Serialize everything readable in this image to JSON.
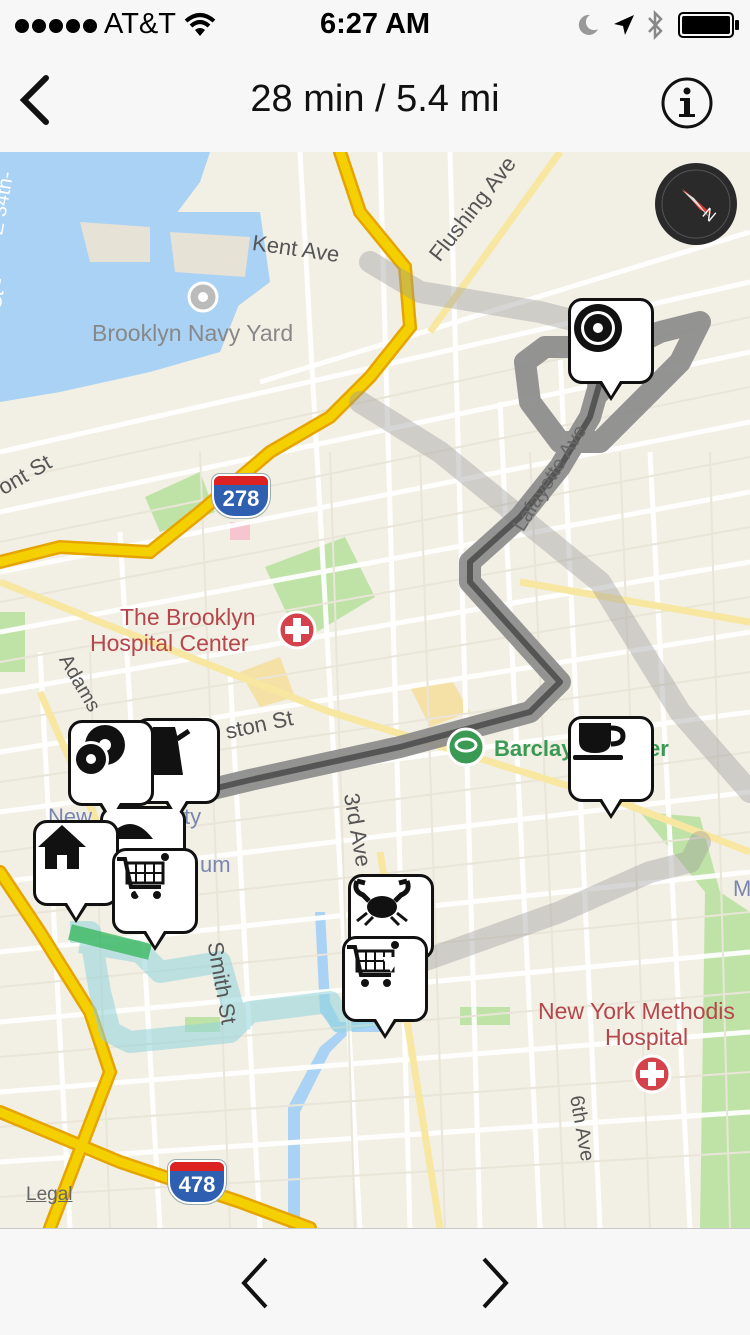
{
  "status_bar": {
    "carrier": "AT&T",
    "time": "6:27 AM",
    "icons": [
      "signal-dots-icon",
      "wifi-icon",
      "moon-icon",
      "location-arrow-icon",
      "bluetooth-icon",
      "battery-icon"
    ]
  },
  "nav": {
    "title": "28 min / 5.4 mi",
    "back_icon": "chevron-left-icon",
    "info_icon": "info-icon"
  },
  "map": {
    "labels": {
      "street_34th": "E 34th-",
      "st_left": "St -",
      "kent_ave": "Kent Ave",
      "flushing_ave": "Flushing Ave",
      "navy_yard": "Brooklyn Navy Yard",
      "front_st": "ont St",
      "hospital_line1": "The Brooklyn",
      "hospital_line2": "Hospital Center",
      "lafayette_ave": "Lafayette Ave",
      "adams": "Adams",
      "livingston": "ston St",
      "barclays": "Barclay",
      "barclays_tail": "er",
      "newy": "New",
      "ty": "ty",
      "um": "um",
      "third_ave": "3rd Ave",
      "smith_st": "Smith St",
      "methodist_line1": "New York Methodis",
      "methodist_line2": "Hospital",
      "sixth_ave": "6th Ave",
      "m_edge": "M",
      "legal": "Legal"
    },
    "shields": [
      "278",
      "478"
    ],
    "pins": [
      {
        "name": "donut-pin",
        "icon": "donut-icon"
      },
      {
        "name": "coffee-cup-pin",
        "icon": "coffee-cup-icon"
      },
      {
        "name": "donut-pin-2",
        "icon": "donut-icon"
      },
      {
        "name": "coffee-pot-pin",
        "icon": "coffee-pot-icon"
      },
      {
        "name": "home-pin",
        "icon": "home-icon"
      },
      {
        "name": "cart-pin",
        "icon": "shopping-cart-icon"
      },
      {
        "name": "crab-pin",
        "icon": "crab-icon"
      },
      {
        "name": "cart-pin-2",
        "icon": "shopping-cart-icon"
      }
    ],
    "compass_icon": "compass-icon"
  },
  "toolbar": {
    "prev_icon": "chevron-left-icon",
    "next_icon": "chevron-right-icon"
  },
  "colors": {
    "water": "#a9d2f4",
    "park": "#bfe3a6",
    "highway": "#f5c400",
    "route_dark": "#7a7a7a",
    "route_light": "#9fd9e0",
    "hospital_red": "#d4434b",
    "label_red": "#b5464b",
    "label_green": "#3a9a54"
  }
}
